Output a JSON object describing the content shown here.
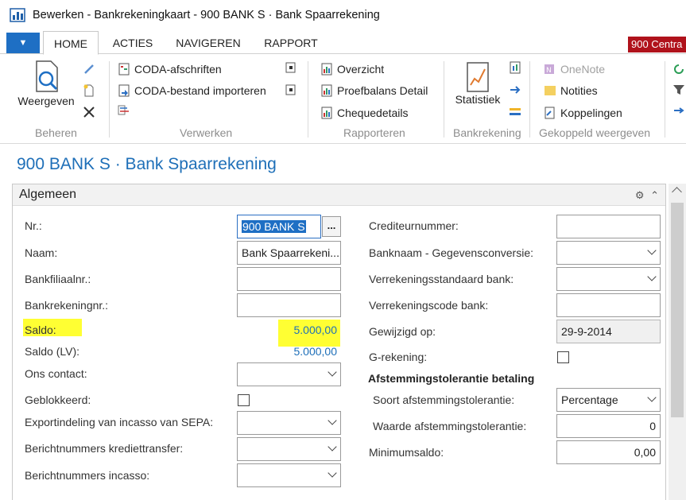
{
  "window": {
    "title": "Bewerken - Bankrekeningkaart - 900 BANK S · Bank Spaarrekening"
  },
  "ribbon_tabs": [
    {
      "label": "HOME",
      "active": true
    },
    {
      "label": "ACTIES",
      "active": false
    },
    {
      "label": "NAVIGEREN",
      "active": false
    },
    {
      "label": "RAPPORT",
      "active": false
    }
  ],
  "company_badge": "900 Centra",
  "ribbon": {
    "beheren": {
      "label": "Beheren",
      "weergeven": "Weergeven"
    },
    "verwerken": {
      "label": "Verwerken",
      "coda_afschriften": "CODA-afschriften",
      "coda_importeren": "CODA-bestand importeren"
    },
    "rapporteren": {
      "label": "Rapporteren",
      "overzicht": "Overzicht",
      "proefbalans": "Proefbalans Detail",
      "chequedetails": "Chequedetails"
    },
    "bankrekening": {
      "label": "Bankrekening",
      "statistiek": "Statistiek"
    },
    "gekoppeld": {
      "label": "Gekoppeld weergeven",
      "onenote": "OneNote",
      "notities": "Notities",
      "koppelingen": "Koppelingen"
    }
  },
  "page": {
    "title": "900 BANK S · Bank Spaarrekening"
  },
  "fasttab": {
    "title": "Algemeen"
  },
  "left_fields": {
    "nr": {
      "label": "Nr.:",
      "value": "900 BANK S"
    },
    "naam": {
      "label": "Naam:",
      "value": "Bank Spaarrekeni..."
    },
    "bankfiliaalnr": {
      "label": "Bankfiliaalnr.:",
      "value": ""
    },
    "bankrekeningnr": {
      "label": "Bankrekeningnr.:",
      "value": ""
    },
    "saldo": {
      "label": "Saldo:",
      "value": "5.000,00"
    },
    "saldo_lv": {
      "label": "Saldo (LV):",
      "value": "5.000,00"
    },
    "ons_contact": {
      "label": "Ons contact:",
      "value": ""
    },
    "geblokkeerd": {
      "label": "Geblokkeerd:",
      "checked": false
    },
    "exportindeling": {
      "label": "Exportindeling van incasso van SEPA:",
      "value": ""
    },
    "berichtnummers_krediet": {
      "label": "Berichtnummers krediettransfer:",
      "value": ""
    },
    "berichtnummers_incasso": {
      "label": "Berichtnummers incasso:",
      "value": ""
    }
  },
  "right_fields": {
    "crediteurnummer": {
      "label": "Crediteurnummer:",
      "value": ""
    },
    "banknaam": {
      "label": "Banknaam - Gegevensconversie:",
      "value": ""
    },
    "verrekeningsstandaard": {
      "label": "Verrekeningsstandaard bank:",
      "value": ""
    },
    "verrekeningscode": {
      "label": "Verrekeningscode bank:",
      "value": ""
    },
    "gewijzigd_op": {
      "label": "Gewijzigd op:",
      "value": "29-9-2014"
    },
    "g_rekening": {
      "label": "G-rekening:",
      "checked": false
    },
    "afstemming_heading": "Afstemmingstolerantie betaling",
    "soort_afstemming": {
      "label": "Soort afstemmingstolerantie:",
      "value": "Percentage"
    },
    "waarde_afstemming": {
      "label": "Waarde afstemmingstolerantie:",
      "value": "0"
    },
    "minimumsaldo": {
      "label": "Minimumsaldo:",
      "value": "0,00"
    }
  },
  "colors": {
    "accent": "#1e6fc4",
    "title_blue": "#1e6fb8",
    "highlight": "#ffff33",
    "company_red": "#b0121b"
  }
}
